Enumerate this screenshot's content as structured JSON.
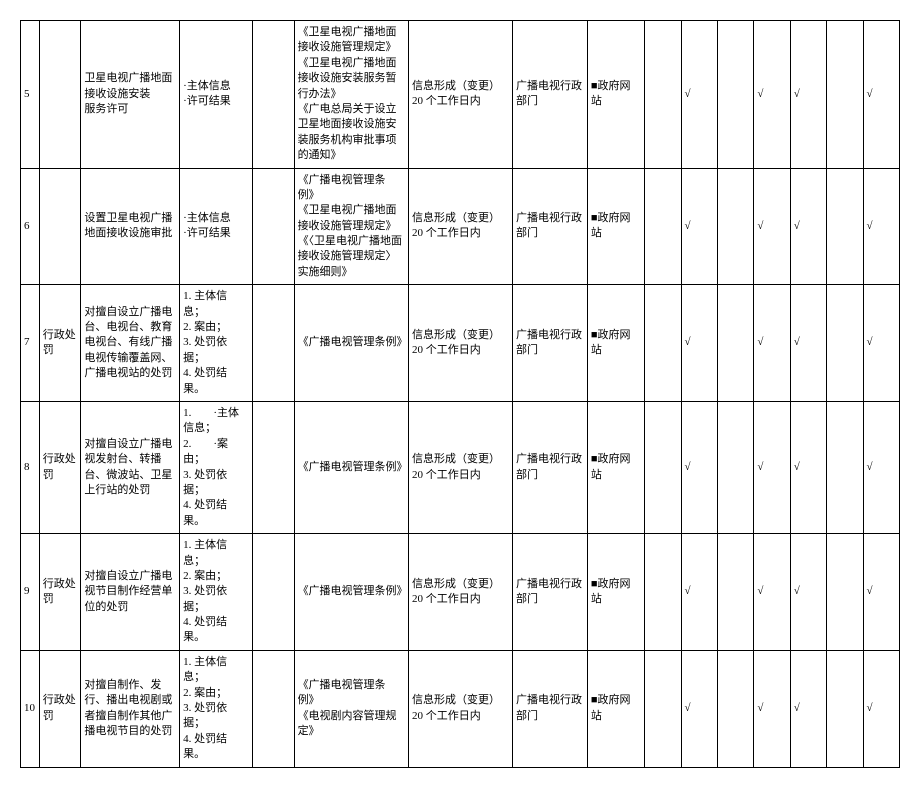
{
  "channel_label": "政府网站",
  "check": "√",
  "rows": [
    {
      "idx": "5",
      "cat": "",
      "item": "卫星电视广播地面接收设施安装\n服务许可",
      "content": "·主体信息\n·许可结果",
      "basis": "《卫星电视广播地面接收设施管理规定》\n《卫星电视广播地面接收设施安装服务暂行办法》\n《广电总局关于设立卫星地面接收设施安装服务机构审批事项的通知》",
      "time": "信息形成（变更）20 个工作日内",
      "dept": "广播电视行政部门"
    },
    {
      "idx": "6",
      "cat": "",
      "item": "设置卫星电视广播地面接收设施审批",
      "content": "·主体信息\n·许可结果",
      "basis": "《广播电视管理条例》\n《卫星电视广播地面接收设施管理规定》\n《〈卫星电视广播地面接收设施管理规定〉实施细则》",
      "time": "信息形成（变更）20 个工作日内",
      "dept": "广播电视行政部门"
    },
    {
      "idx": "7",
      "cat": "行政处罚",
      "item": "对擅自设立广播电台、电视台、教育电视台、有线广播电视传输覆盖网、广播电视站的处罚",
      "content": "1. 主体信息；\n2. 案由；\n3. 处罚依据；\n4. 处罚结果。",
      "basis": "《广播电视管理条例》",
      "time": "信息形成（变更）20 个工作日内",
      "dept": "广播电视行政部门"
    },
    {
      "idx": "8",
      "cat": "行政处罚",
      "item": "对擅自设立广播电视发射台、转播台、微波站、卫星上行站的处罚",
      "content": "1.　　·主体信息；\n2.　　·案由；\n3. 处罚依据；\n4. 处罚结果。",
      "basis": "《广播电视管理条例》",
      "time": "信息形成（变更）20 个工作日内",
      "dept": "广播电视行政部门"
    },
    {
      "idx": "9",
      "cat": "行政处罚",
      "item": "对擅自设立广播电视节目制作经营单位的处罚",
      "content": "1. 主体信息；\n2. 案由；\n3. 处罚依据；\n4. 处罚结果。",
      "basis": "《广播电视管理条例》",
      "time": "信息形成（变更）20 个工作日内",
      "dept": "广播电视行政部门"
    },
    {
      "idx": "10",
      "cat": "行政处罚",
      "item": "对擅自制作、发行、播出电视剧或者擅自制作其他广播电视节目的处罚",
      "content": "1. 主体信息；\n2. 案由；\n3. 处罚依据；\n4. 处罚结果。",
      "basis": "《广播电视管理条例》\n《电视剧内容管理规定》",
      "time": "信息形成（变更）20 个工作日内",
      "dept": "广播电视行政部门"
    }
  ]
}
